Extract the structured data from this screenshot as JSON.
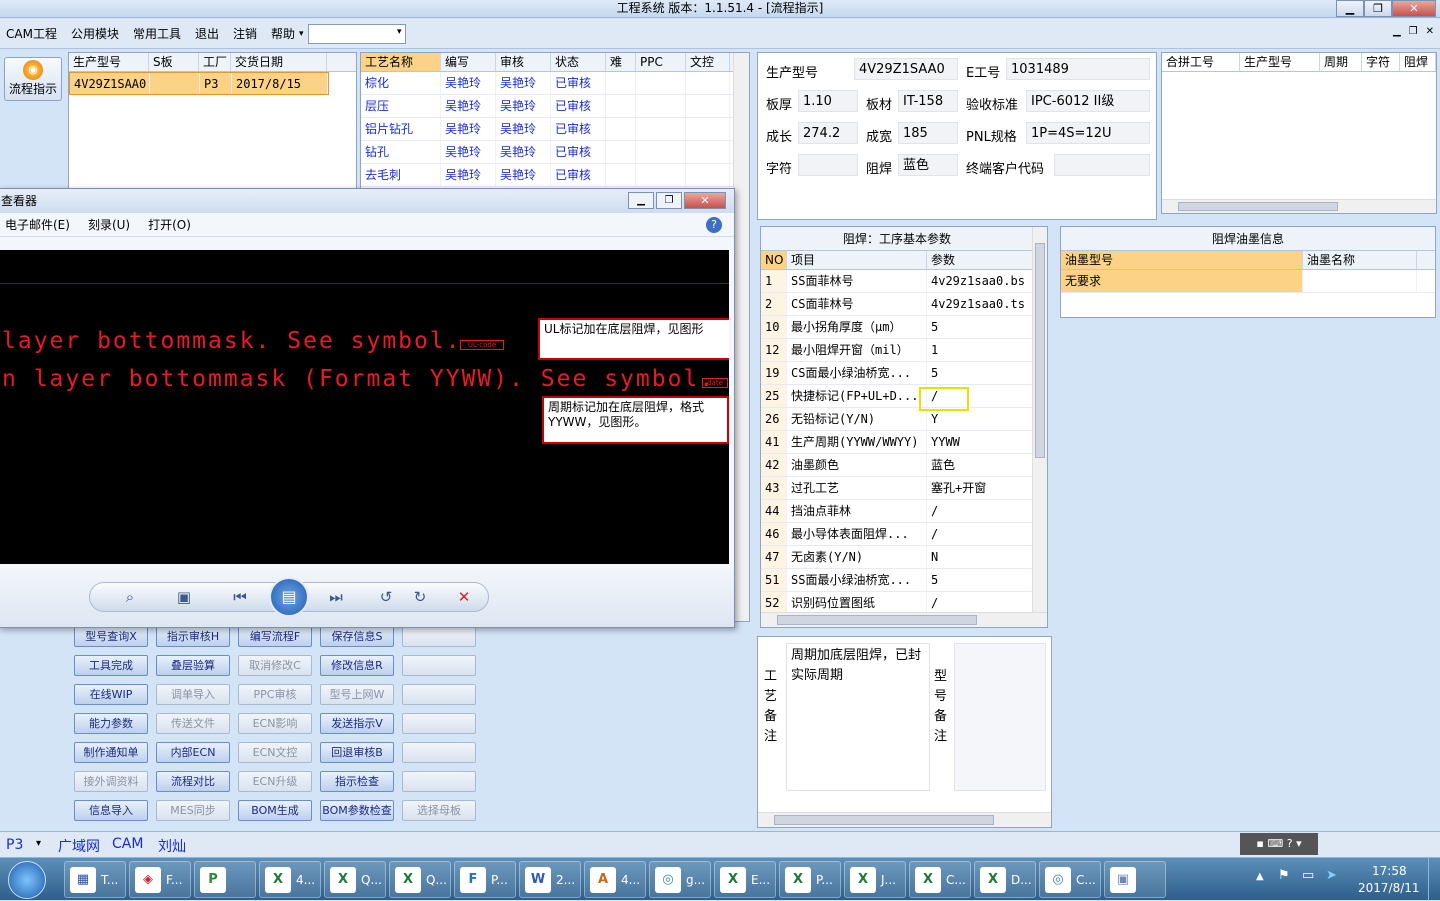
{
  "window": {
    "title": "工程系统    版本：1.1.51.4 - [流程指示]"
  },
  "menu": [
    "CAM工程",
    "公用模块",
    "常用工具",
    "退出",
    "注销",
    "帮助"
  ],
  "left_tool": {
    "label": "流程指示"
  },
  "jobs": {
    "columns": [
      "生产型号",
      "S板",
      "工厂",
      "交货日期"
    ],
    "rows": [
      [
        "4V29Z1SAA0",
        "",
        "P3",
        "2017/8/15"
      ]
    ]
  },
  "process": {
    "columns": [
      "工艺名称",
      "编写",
      "审核",
      "状态",
      "难",
      "PPC",
      "文控"
    ],
    "rows": [
      [
        "棕化",
        "吴艳玲",
        "吴艳玲",
        "已审核"
      ],
      [
        "层压",
        "吴艳玲",
        "吴艳玲",
        "已审核"
      ],
      [
        "铝片钻孔",
        "吴艳玲",
        "吴艳玲",
        "已审核"
      ],
      [
        "钻孔",
        "吴艳玲",
        "吴艳玲",
        "已审核"
      ],
      [
        "去毛刺",
        "吴艳玲",
        "吴艳玲",
        "已审核"
      ]
    ]
  },
  "info": {
    "model_label": "生产型号",
    "model": "4V29Z1SAA0",
    "e_label": "E工号",
    "e": "1031489",
    "thick_label": "板厚",
    "thick": "1.10",
    "mat_label": "板材",
    "mat": "IT-158",
    "std_label": "验收标准",
    "std": "IPC-6012 II级",
    "len_label": "成长",
    "len": "274.2",
    "wid_label": "成宽",
    "wid": "185",
    "pnl_label": "PNL规格",
    "pnl": "1P=4S=12U",
    "char_label": "字符",
    "char": "",
    "mask_label": "阻焊",
    "mask": "蓝色",
    "cust_label": "终端客户代码",
    "cust": ""
  },
  "merge": {
    "columns": [
      "合拼工号",
      "生产型号",
      "周期",
      "字符",
      "阻焊"
    ]
  },
  "params": {
    "title": "阻焊：工序基本参数",
    "columns": [
      "NO",
      "项目",
      "参数"
    ],
    "rows": [
      [
        "1",
        "SS面菲林号",
        "4v29z1saa0.bs"
      ],
      [
        "2",
        "CS面菲林号",
        "4v29z1saa0.ts"
      ],
      [
        "10",
        "最小拐角厚度（μm）",
        "5"
      ],
      [
        "12",
        "最小阻焊开窗（mil）",
        "1"
      ],
      [
        "19",
        "CS面最小绿油桥宽...",
        "5"
      ],
      [
        "25",
        "快捷标记(FP+UL+D...",
        "/"
      ],
      [
        "26",
        "无铅标记(Y/N)",
        "Y"
      ],
      [
        "41",
        "生产周期(YYWW/WWYY)",
        "YYWW"
      ],
      [
        "42",
        "油墨颜色",
        "蓝色"
      ],
      [
        "43",
        "过孔工艺",
        "塞孔+开窗"
      ],
      [
        "44",
        "挡油点菲林",
        "/"
      ],
      [
        "46",
        "最小导体表面阻焊...",
        "/"
      ],
      [
        "47",
        "无卤素(Y/N)",
        "N"
      ],
      [
        "51",
        "SS面最小绿油桥宽...",
        "5"
      ],
      [
        "52",
        "识别码位置图纸",
        "/"
      ]
    ]
  },
  "ink": {
    "title": "阻焊油墨信息",
    "columns": [
      "油墨型号",
      "油墨名称"
    ],
    "rows": [
      [
        "无要求",
        ""
      ]
    ]
  },
  "notes": {
    "process_label": "工艺备注",
    "process_text": "周期加底层阻焊，已封实际周期",
    "model_label": "型号备注"
  },
  "buttons": [
    [
      "型号查询X",
      "指示审核H",
      "编写流程F",
      "保存信息S",
      ""
    ],
    [
      "工具完成",
      "叠层验算",
      "取消修改C",
      "修改信息R",
      ""
    ],
    [
      "在线WIP",
      "调单导入",
      "PPC审核",
      "型号上网W",
      ""
    ],
    [
      "能力参数",
      "传送文件",
      "ECN影响",
      "发送指示V",
      ""
    ],
    [
      "制作通知单",
      "内部ECN",
      "ECN文控",
      "回退审核B",
      ""
    ],
    [
      "接外调资料",
      "流程对比",
      "ECN升级",
      "指示检查",
      ""
    ],
    [
      "信息导入",
      "MES同步",
      "BOM生成",
      "BOM参数检查",
      "选择母板"
    ]
  ],
  "viewer": {
    "title": "查看器",
    "menus": [
      "电子邮件(E)",
      "刻录(U)",
      "打开(O)"
    ],
    "line1": "layer bottommask. See symbol.",
    "line2": "n layer bottommask (Format YYWW). See symbol.",
    "tag1": "UL-code",
    "tag2": "date",
    "callout1": "UL标记加在底层阻焊，见图形",
    "callout2": "周期标记加在底层阻焊，格式YYWW，见图形。"
  },
  "status": {
    "factory": "P3",
    "net": "广域网",
    "cam": "CAM",
    "user": "刘灿"
  },
  "taskbar": {
    "items": [
      "T...",
      "F...",
      "",
      "4...",
      "Q...",
      "Q...",
      "P...",
      "2...",
      "4...",
      "g...",
      "E...",
      "P...",
      "J...",
      "C...",
      "D...",
      "C...",
      ""
    ],
    "time": "17:58",
    "date": "2017/8/11"
  }
}
